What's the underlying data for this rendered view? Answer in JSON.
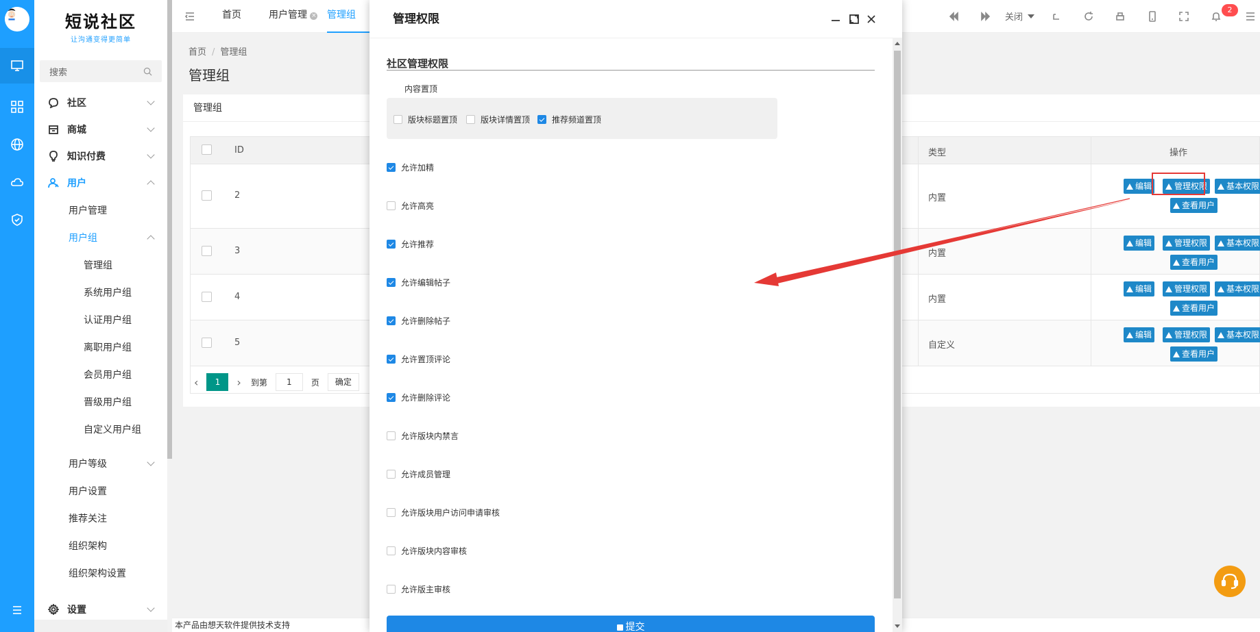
{
  "colors": {
    "primary": "#1e9fff",
    "action_btn": "#1e88c8",
    "pager_active": "#009688",
    "annotation_red": "#e53935",
    "checked": "#1e88e5"
  },
  "logo": {
    "title": "短说社区",
    "slogan": "让沟通变得更简单"
  },
  "sidebar": {
    "search_placeholder": "搜索",
    "menu": [
      {
        "label": "社区",
        "icon": "chat-icon"
      },
      {
        "label": "商城",
        "icon": "shop-icon"
      },
      {
        "label": "知识付费",
        "icon": "lightbulb-icon"
      },
      {
        "label": "用户",
        "icon": "user-icon"
      },
      {
        "label": "用户管理"
      },
      {
        "label": "用户组"
      },
      {
        "label": "管理组"
      },
      {
        "label": "系统用户组"
      },
      {
        "label": "认证用户组"
      },
      {
        "label": "离职用户组"
      },
      {
        "label": "会员用户组"
      },
      {
        "label": "晋级用户组"
      },
      {
        "label": "自定义用户组"
      },
      {
        "label": "用户等级"
      },
      {
        "label": "用户设置"
      },
      {
        "label": "推荐关注"
      },
      {
        "label": "组织架构"
      },
      {
        "label": "组织架构设置"
      },
      {
        "label": "设置",
        "icon": "gear-icon"
      }
    ]
  },
  "topbar": {
    "tabs": [
      "首页",
      "用户管理",
      "管理组"
    ],
    "close_label": "关闭",
    "notification_count": "2"
  },
  "breadcrumb": {
    "home": "首页",
    "current": "管理组"
  },
  "page_title": "管理组",
  "card_title": "管理组",
  "table": {
    "headers": {
      "id": "ID",
      "type": "类型",
      "ops": "操作"
    },
    "rows": [
      {
        "id": "2",
        "type": "内置"
      },
      {
        "id": "3",
        "type": "内置"
      },
      {
        "id": "4",
        "type": "内置"
      },
      {
        "id": "5",
        "type": "自定义"
      }
    ],
    "actions": {
      "edit": "编辑",
      "manage": "管理权限",
      "basic": "基本权限",
      "view": "查看用户"
    }
  },
  "pager": {
    "current": "1",
    "goto": "到第",
    "page_input": "1",
    "page_unit": "页",
    "confirm": "确定"
  },
  "footer": "本产品由想天软件提供技术支持",
  "modal": {
    "title": "管理权限",
    "section": "社区管理权限",
    "sub_label": "内容置顶",
    "sub_options": [
      {
        "label": "版块标题置顶",
        "checked": false
      },
      {
        "label": "版块详情置顶",
        "checked": false
      },
      {
        "label": "推荐频道置顶",
        "checked": true
      }
    ],
    "options": [
      {
        "label": "允许加精",
        "checked": true
      },
      {
        "label": "允许高亮",
        "checked": false
      },
      {
        "label": "允许推荐",
        "checked": true
      },
      {
        "label": "允许编辑帖子",
        "checked": true
      },
      {
        "label": "允许删除帖子",
        "checked": true
      },
      {
        "label": "允许置顶评论",
        "checked": true
      },
      {
        "label": "允许删除评论",
        "checked": true
      },
      {
        "label": "允许版块内禁言",
        "checked": false
      },
      {
        "label": "允许成员管理",
        "checked": false
      },
      {
        "label": "允许版块用户访问申请审核",
        "checked": false
      },
      {
        "label": "允许版块内容审核",
        "checked": false
      },
      {
        "label": "允许版主审核",
        "checked": false
      }
    ],
    "submit": "提交"
  }
}
